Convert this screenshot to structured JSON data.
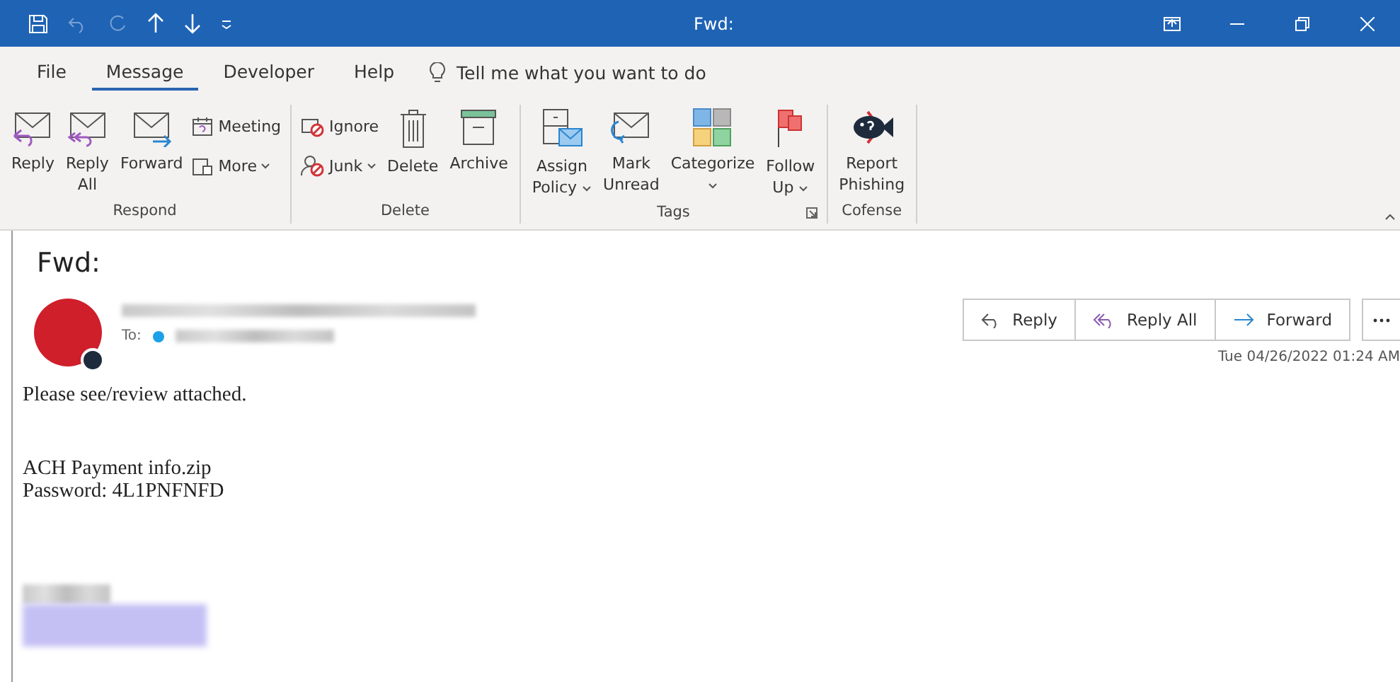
{
  "title_bar": {
    "title": "Fwd:"
  },
  "tabs": [
    {
      "label": "File",
      "selected": false
    },
    {
      "label": "Message",
      "selected": true
    },
    {
      "label": "Developer",
      "selected": false
    },
    {
      "label": "Help",
      "selected": false
    }
  ],
  "tell_me": {
    "placeholder": "Tell me what you want to do"
  },
  "ribbon": {
    "groups": [
      {
        "label": "Respond",
        "launcher": false,
        "buttons": [
          {
            "label": "Reply",
            "kind": "large",
            "dropdown": false
          },
          {
            "label": "Reply\nAll",
            "kind": "large",
            "dropdown": false
          },
          {
            "label": "Forward",
            "kind": "large",
            "dropdown": false
          },
          {
            "label": "Meeting",
            "kind": "small",
            "dropdown": false
          },
          {
            "label": "More",
            "kind": "small",
            "dropdown": true
          }
        ]
      },
      {
        "label": "Delete",
        "launcher": false,
        "buttons": [
          {
            "label": "Ignore",
            "kind": "small",
            "dropdown": false
          },
          {
            "label": "Junk",
            "kind": "small",
            "dropdown": true
          },
          {
            "label": "Delete",
            "kind": "large",
            "dropdown": false
          },
          {
            "label": "Archive",
            "kind": "large",
            "dropdown": false
          }
        ]
      },
      {
        "label": "Tags",
        "launcher": true,
        "buttons": [
          {
            "label": "Assign\nPolicy",
            "kind": "large",
            "dropdown": true
          },
          {
            "label": "Mark\nUnread",
            "kind": "large",
            "dropdown": false
          },
          {
            "label": "Categorize\n",
            "kind": "large",
            "dropdown": true
          },
          {
            "label": "Follow\nUp",
            "kind": "large",
            "dropdown": true
          }
        ]
      },
      {
        "label": "Cofense",
        "launcher": false,
        "buttons": [
          {
            "label": "Report\nPhishing",
            "kind": "large",
            "dropdown": false
          }
        ]
      }
    ]
  },
  "message": {
    "subject": "Fwd:",
    "to_label": "To:",
    "actions": [
      {
        "label": "Reply"
      },
      {
        "label": "Reply All"
      },
      {
        "label": "Forward"
      }
    ],
    "date": "Tue 04/26/2022 01:24 AM",
    "body": [
      "Please see/review attached.",
      "ACH Payment info.zip\nPassword: 4L1PNFNFD"
    ]
  }
}
